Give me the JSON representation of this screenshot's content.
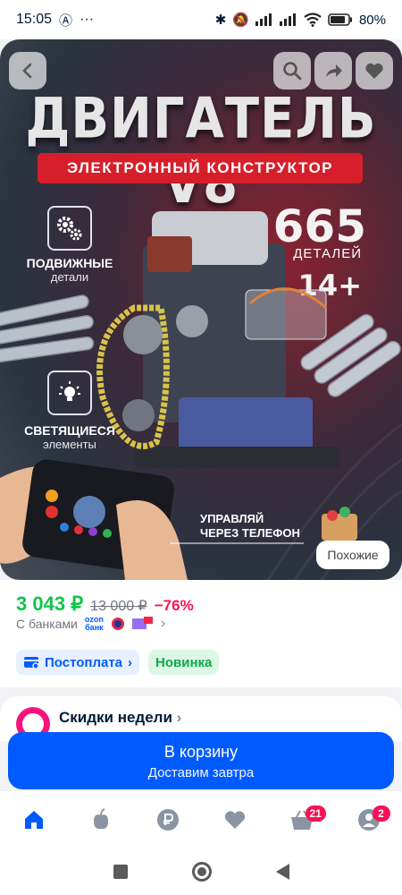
{
  "status": {
    "time": "15:05",
    "battery": "80%"
  },
  "hero": {
    "title": "ДВИГАТЕЛЬ V8",
    "subtitle": "ЭЛЕКТРОННЫЙ КОНСТРУКТОР",
    "feature1_title": "ПОДВИЖНЫЕ",
    "feature1_sub": "детали",
    "feature2_title": "СВЕТЯЩИЕСЯ",
    "feature2_sub": "элементы",
    "count": "665",
    "count_label": "ДЕТАЛЕЙ",
    "age": "14+",
    "phone_line1": "УПРАВЛЯЙ",
    "phone_line2": "ЧЕРЕЗ ТЕЛЕФОН",
    "similar": "Похожие"
  },
  "product": {
    "price": "3 043 ₽",
    "old_price": "13 000 ₽",
    "discount": "−76%",
    "banks_label": "С банками",
    "ozon_logo_top": "ozon",
    "ozon_logo_bottom": "банк",
    "chip_postpay": "Постоплата",
    "chip_new": "Новинка"
  },
  "weekly": {
    "title": "Скидки недели"
  },
  "cart": {
    "button": "В корзину",
    "delivery": "Доставим завтра"
  },
  "tabs": {
    "cart_badge": "21",
    "profile_badge": "2"
  },
  "colors": {
    "brand": "#005bff",
    "price": "#10c44c",
    "discount": "#f91155"
  }
}
